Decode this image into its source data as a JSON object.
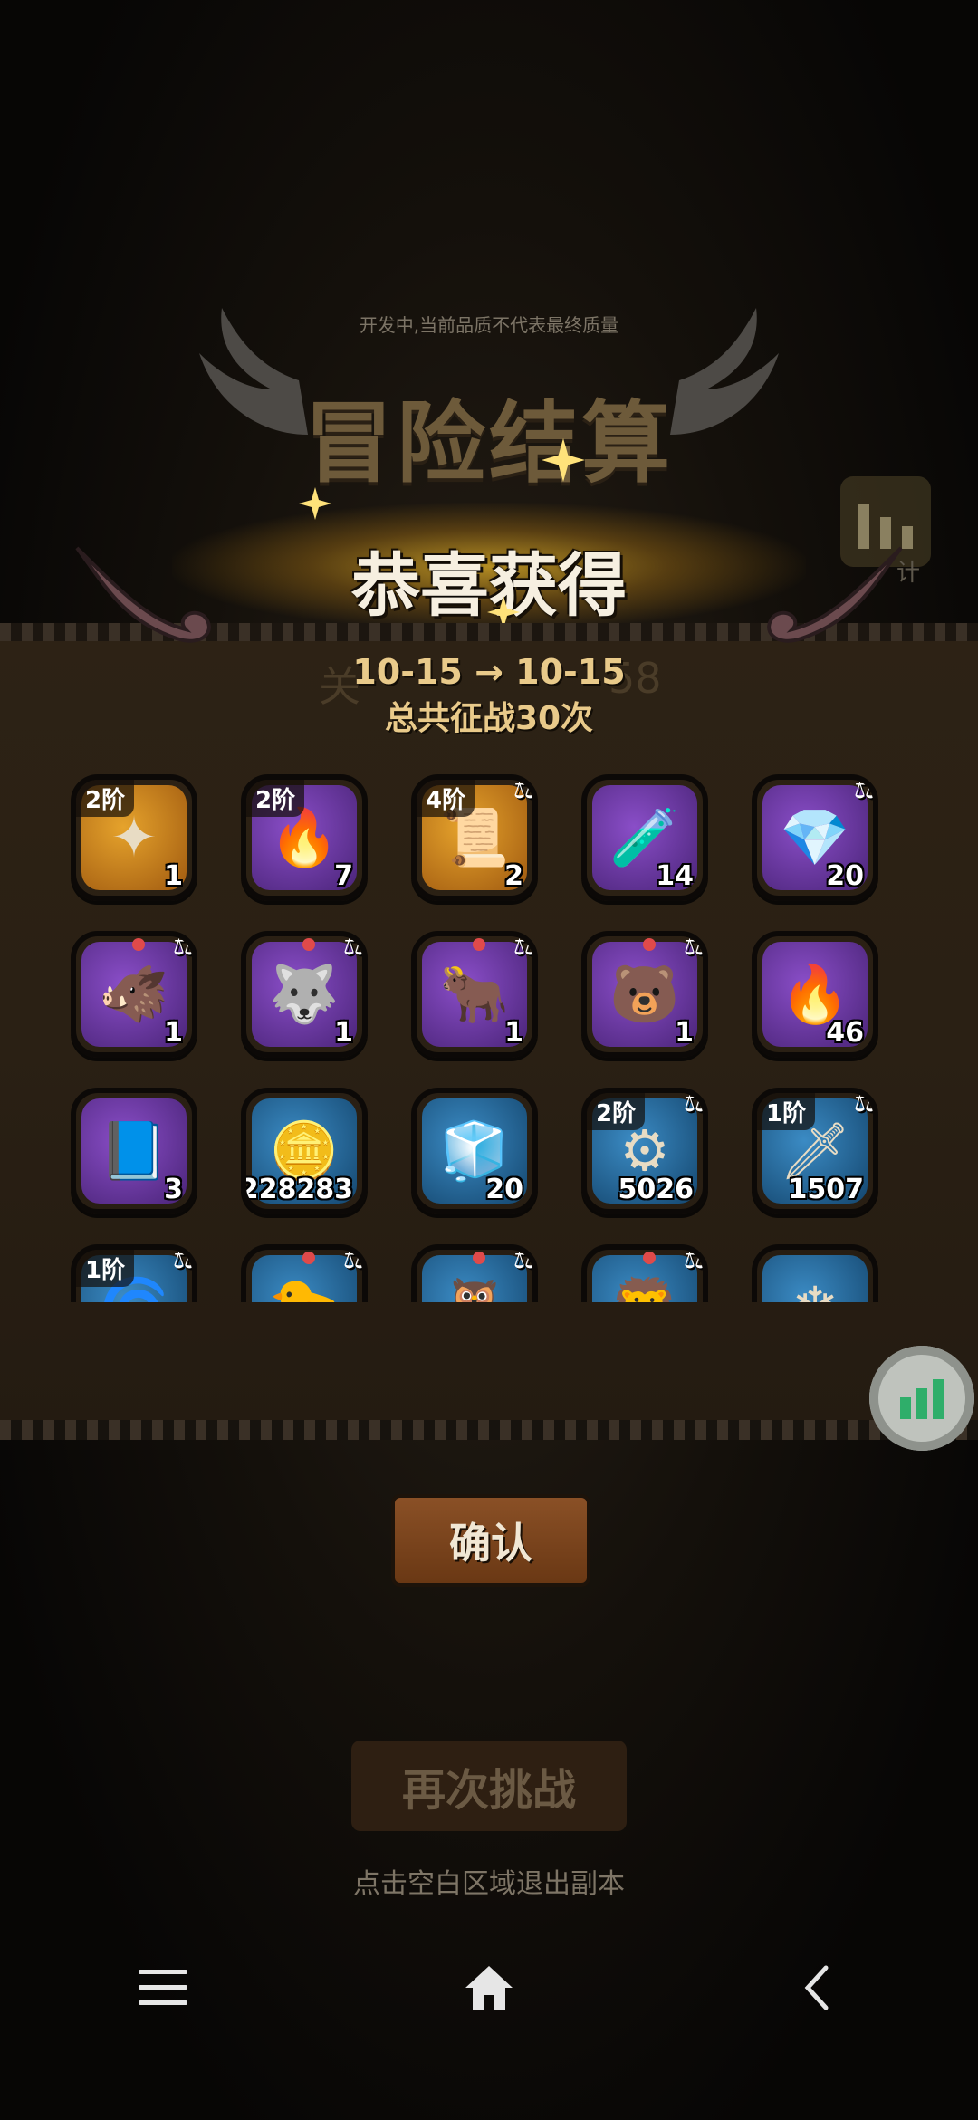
{
  "header": {
    "dev_note": "开发中,当前品质不代表最终质量",
    "title": "冒险结算",
    "congrats": "恭喜获得",
    "stats_label": "计"
  },
  "summary": {
    "level_progress": "10-15 → 10-15",
    "total_battles": "总共征战30次",
    "ghost_left": "关",
    "ghost_right": "58"
  },
  "items": [
    {
      "tier": "2阶",
      "qty": "1",
      "scale": false,
      "dot": false,
      "color": "gold",
      "glyph": "✦"
    },
    {
      "tier": "2阶",
      "qty": "7",
      "scale": false,
      "dot": false,
      "color": "purple",
      "glyph": "🔥"
    },
    {
      "tier": "4阶",
      "qty": "2",
      "scale": true,
      "dot": false,
      "color": "gold",
      "glyph": "📜"
    },
    {
      "tier": "",
      "qty": "14",
      "scale": false,
      "dot": false,
      "color": "purple",
      "glyph": "🧪"
    },
    {
      "tier": "",
      "qty": "20",
      "scale": true,
      "dot": false,
      "color": "purple",
      "glyph": "💎"
    },
    {
      "tier": "",
      "qty": "1",
      "scale": true,
      "dot": true,
      "color": "purple",
      "glyph": "🐗"
    },
    {
      "tier": "",
      "qty": "1",
      "scale": true,
      "dot": true,
      "color": "purple",
      "glyph": "🐺"
    },
    {
      "tier": "",
      "qty": "1",
      "scale": true,
      "dot": true,
      "color": "purple",
      "glyph": "🐂"
    },
    {
      "tier": "",
      "qty": "1",
      "scale": true,
      "dot": true,
      "color": "purple",
      "glyph": "🐻"
    },
    {
      "tier": "",
      "qty": "46",
      "scale": false,
      "dot": false,
      "color": "purple",
      "glyph": "🔥"
    },
    {
      "tier": "",
      "qty": "3",
      "scale": false,
      "dot": false,
      "color": "purple",
      "glyph": "📘"
    },
    {
      "tier": "",
      "qty": "228283",
      "scale": false,
      "dot": false,
      "color": "blue",
      "glyph": "🪙"
    },
    {
      "tier": "",
      "qty": "20",
      "scale": false,
      "dot": false,
      "color": "blue",
      "glyph": "🧊"
    },
    {
      "tier": "2阶",
      "qty": "5026",
      "scale": true,
      "dot": false,
      "color": "blue",
      "glyph": "⚙"
    },
    {
      "tier": "1阶",
      "qty": "1507",
      "scale": true,
      "dot": false,
      "color": "blue",
      "glyph": "🗡"
    },
    {
      "tier": "1阶",
      "qty": "",
      "scale": true,
      "dot": false,
      "color": "blue",
      "glyph": "🌀"
    },
    {
      "tier": "",
      "qty": "",
      "scale": true,
      "dot": true,
      "color": "blue",
      "glyph": "🐤"
    },
    {
      "tier": "",
      "qty": "",
      "scale": true,
      "dot": true,
      "color": "blue",
      "glyph": "🦉"
    },
    {
      "tier": "",
      "qty": "",
      "scale": true,
      "dot": true,
      "color": "blue",
      "glyph": "🦁"
    },
    {
      "tier": "",
      "qty": "",
      "scale": false,
      "dot": false,
      "color": "blue",
      "glyph": "❄"
    }
  ],
  "buttons": {
    "confirm": "确认",
    "retry": "再次挑战"
  },
  "exit_hint": "点击空白区域退出副本",
  "navbar": {
    "menu_icon": "menu-icon",
    "home_icon": "home-icon",
    "back_icon": "back-icon"
  },
  "colors": {
    "accent_gold": "#e9ca8a",
    "confirm_bg": "#7a4420",
    "float_btn": "#bfc3bd"
  }
}
